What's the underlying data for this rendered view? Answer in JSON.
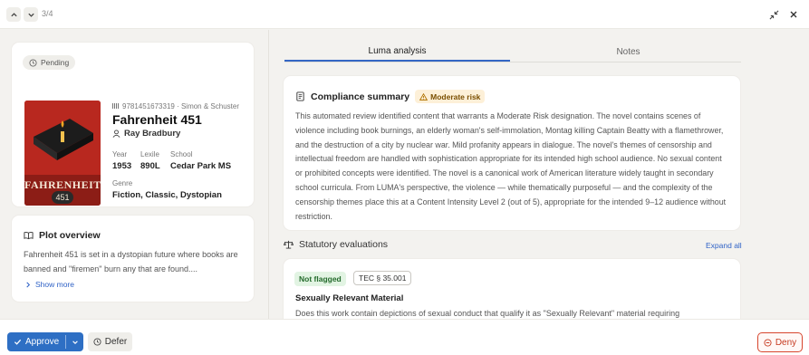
{
  "topbar": {
    "counter": "3/4"
  },
  "book": {
    "status": "Pending",
    "isbn_publisher": "9781451673319 · Simon & Schuster",
    "title": "Fahrenheit 451",
    "author": "Ray Bradbury",
    "cover_text": "FAHRENHEIT",
    "cover_number": "451",
    "fields": {
      "year_label": "Year",
      "year": "1953",
      "lexile_label": "Lexile",
      "lexile": "890L",
      "school_label": "School",
      "school": "Cedar Park MS",
      "genre_label": "Genre",
      "genre": "Fiction, Classic, Dystopian"
    }
  },
  "plot": {
    "title": "Plot overview",
    "text": "Fahrenheit 451 is set in a dystopian future where books are banned and \"firemen\" burn any that are found....",
    "show_more": "Show more"
  },
  "tabs": [
    {
      "label": "Luma analysis",
      "active": true
    },
    {
      "label": "Notes",
      "active": false
    }
  ],
  "compliance": {
    "title": "Compliance summary",
    "risk_badge": "Moderate risk",
    "text": "This automated review identified content that warrants a Moderate Risk designation. The novel contains scenes of violence including book burnings, an elderly woman's self-immolation, Montag killing Captain Beatty with a flamethrower, and the destruction of a city by nuclear war. Mild profanity appears in dialogue. The novel's themes of censorship and intellectual freedom are handled with sophistication appropriate for its intended high school audience. No sexual content or prohibited concepts were identified. The novel is a canonical work of American literature widely taught in secondary school curricula. From LUMA's perspective, the violence — while thematically purposeful — and the complexity of the censorship themes place this at a Content Intensity Level 2 (out of 5), appropriate for the intended 9–12 audience without restriction."
  },
  "statutory": {
    "title": "Statutory evaluations",
    "expand_all": "Expand all",
    "items": [
      {
        "status": "Not flagged",
        "code": "TEC § 35.001",
        "title": "Sexually Relevant Material",
        "text": "Does this work contain depictions of sexual conduct that qualify it as \"Sexually Relevant\" material requiring"
      }
    ]
  },
  "actions": {
    "approve": "Approve",
    "defer": "Defer",
    "deny": "Deny"
  },
  "colors": {
    "accent": "#2e6fc4",
    "deny": "#d7462e",
    "warn_bg": "#fdf0d8",
    "ok_bg": "#e2f4e3",
    "cover": "#b8281f"
  }
}
